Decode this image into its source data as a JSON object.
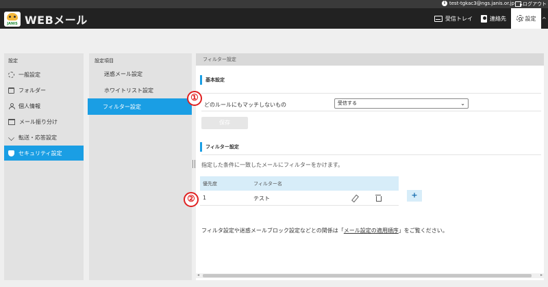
{
  "topstrip": {
    "account": "test-tgkac3@ngs.janis.or.jp",
    "logout_label": "ログアウト"
  },
  "header": {
    "logo_text": "JANIS",
    "app_title": "WEBメール",
    "nav": {
      "inbox": "受信トレイ",
      "contacts": "連絡先",
      "settings": "設定"
    }
  },
  "sidebar": {
    "title": "設定",
    "items": [
      {
        "label": "一般設定",
        "icon": "gear-icon"
      },
      {
        "label": "フォルダー",
        "icon": "folder-icon"
      },
      {
        "label": "個人情報",
        "icon": "person-icon"
      },
      {
        "label": "メール振り分け",
        "icon": "folders-icon"
      },
      {
        "label": "転送・応答設定",
        "icon": "forward-icon"
      },
      {
        "label": "セキュリティ設定",
        "icon": "shield-icon",
        "active": true
      }
    ]
  },
  "submenu": {
    "title": "設定項目",
    "items": [
      {
        "label": "迷惑メール設定"
      },
      {
        "label": "ホワイトリスト設定"
      },
      {
        "label": "フィルター設定",
        "active": true
      }
    ]
  },
  "main": {
    "header": "フィルター設定",
    "basic": {
      "title": "基本設定",
      "rule_label": "どのルールにもマッチしないもの",
      "select_value": "受信する",
      "save_label": "保存"
    },
    "filter": {
      "title": "フィルター設定",
      "description": "指定した条件に一致したメールにフィルターをかけます。",
      "columns": {
        "priority": "優先度",
        "name": "フィルター名"
      },
      "rows": [
        {
          "priority": "1",
          "name": "テスト"
        }
      ],
      "add_label": "+"
    },
    "note": {
      "before": "フィルタ設定や迷惑メールブロック設定などとの関係は「",
      "link": "メール設定の適用順序",
      "after": "」をご覧ください。"
    }
  },
  "annotations": {
    "one": "①",
    "two": "②"
  },
  "colors": {
    "accent": "#1a9ee4",
    "annotation": "#e02020",
    "header_bg": "#222222"
  }
}
